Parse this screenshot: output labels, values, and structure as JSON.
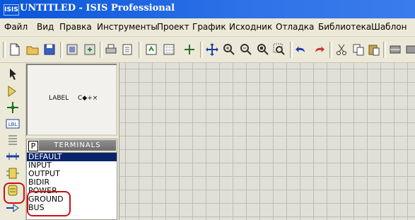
{
  "window": {
    "title": "UNTITLED - ISIS Professional",
    "app_icon": "ISIS"
  },
  "menu": [
    "Файл",
    "Вид",
    "Правка",
    "Инструменты",
    "Проект",
    "График",
    "Исходник",
    "Отладка",
    "Библиотека",
    "Шаблон"
  ],
  "toolbar_icons": [
    "new-file-icon",
    "open-folder-icon",
    "save-icon",
    "import-icon",
    "export-icon",
    "print-icon",
    "print-area-icon",
    "refresh-icon",
    "grid-icon",
    "origin-icon",
    "pan-icon",
    "zoom-in-icon",
    "zoom-out-icon",
    "zoom-all-icon",
    "zoom-area-icon",
    "undo-icon",
    "redo-icon",
    "cut-icon",
    "copy-icon",
    "paste-icon",
    "block-copy-icon",
    "block-move-icon"
  ],
  "preview": {
    "label_text": "LABEL",
    "symbol_text": "C◆+×"
  },
  "device_selector": {
    "p_button": "P",
    "title": "TERMINALS",
    "items": [
      "DEFAULT",
      "INPUT",
      "OUTPUT",
      "BIDIR",
      "POWER",
      "GROUND",
      "BUS"
    ],
    "selected_index": 0
  },
  "left_tools": [
    "pointer-icon",
    "component-icon",
    "junction-icon",
    "wire-label-icon",
    "text-script-icon",
    "bus-icon",
    "subcircuit-icon",
    "terminal-icon",
    "pin-icon"
  ],
  "colors": {
    "title_bar": "#0a56d8",
    "selection": "#0a246a",
    "highlight": "#cc1010"
  }
}
